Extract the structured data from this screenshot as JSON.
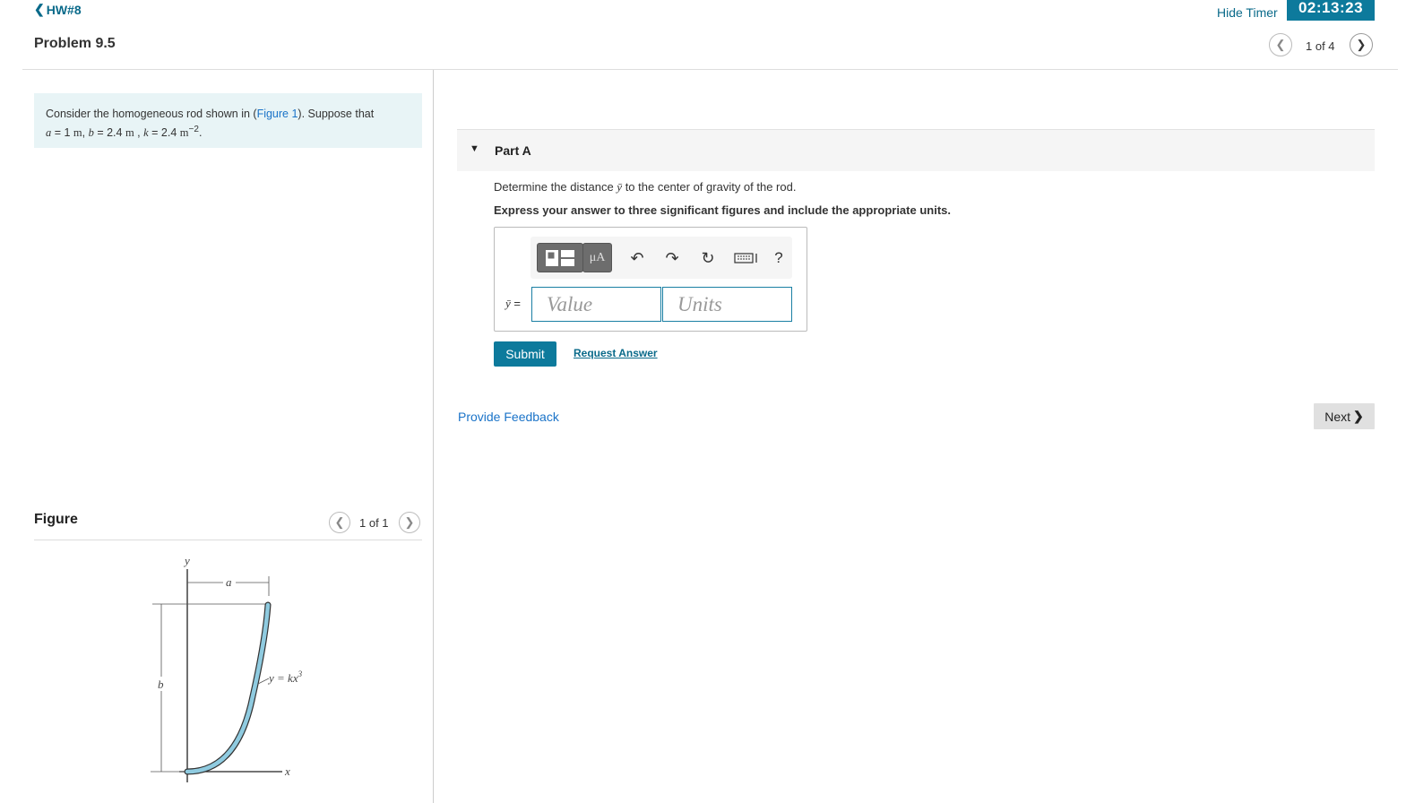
{
  "header": {
    "back_label": "HW#8",
    "problem_title": "Problem 9.5",
    "hide_timer_label": "Hide Timer",
    "timer": "02:13:23",
    "pager": "1 of 4"
  },
  "intro": {
    "text_before": "Consider the homogeneous rod shown in (",
    "figure_link": "Figure 1",
    "text_after": "). Suppose that",
    "a_var": "a",
    "a_val": " = 1 ",
    "a_unit": "m",
    "b_var": "b",
    "b_val": " = 2.4 ",
    "b_unit": "m",
    "k_var": "k",
    "k_val": " = 2.4 ",
    "k_unit": "m",
    "k_exp": "−2"
  },
  "figure": {
    "title": "Figure",
    "pager": "1 of 1",
    "labels": {
      "y_axis": "y",
      "x_axis": "x",
      "a": "a",
      "b": "b",
      "equation": "y = kx",
      "equation_exp": "3"
    }
  },
  "part": {
    "label": "Part A",
    "question_before": "Determine the distance ",
    "question_var": "ȳ",
    "question_after": " to the center of gravity of the rod.",
    "instruction": "Express your answer to three significant figures and include the appropriate units."
  },
  "answer": {
    "var_label": "ȳ",
    "equals": " =",
    "value_placeholder": "Value",
    "units_placeholder": "Units",
    "units_tool_label": "μA",
    "help_label": "?"
  },
  "actions": {
    "submit_label": "Submit",
    "request_answer_label": "Request Answer",
    "feedback_label": "Provide Feedback",
    "next_label": "Next"
  },
  "icons": {
    "back": "chevron-left-icon",
    "prev": "chevron-left-icon",
    "next": "chevron-right-icon",
    "undo": "undo-icon",
    "redo": "redo-icon",
    "reset": "reset-icon",
    "keyboard": "keyboard-icon"
  },
  "colors": {
    "accent": "#0d7a9c",
    "link": "#1a73c8",
    "intro_bg": "#e8f4f6",
    "rod": "#8fcbe0"
  }
}
